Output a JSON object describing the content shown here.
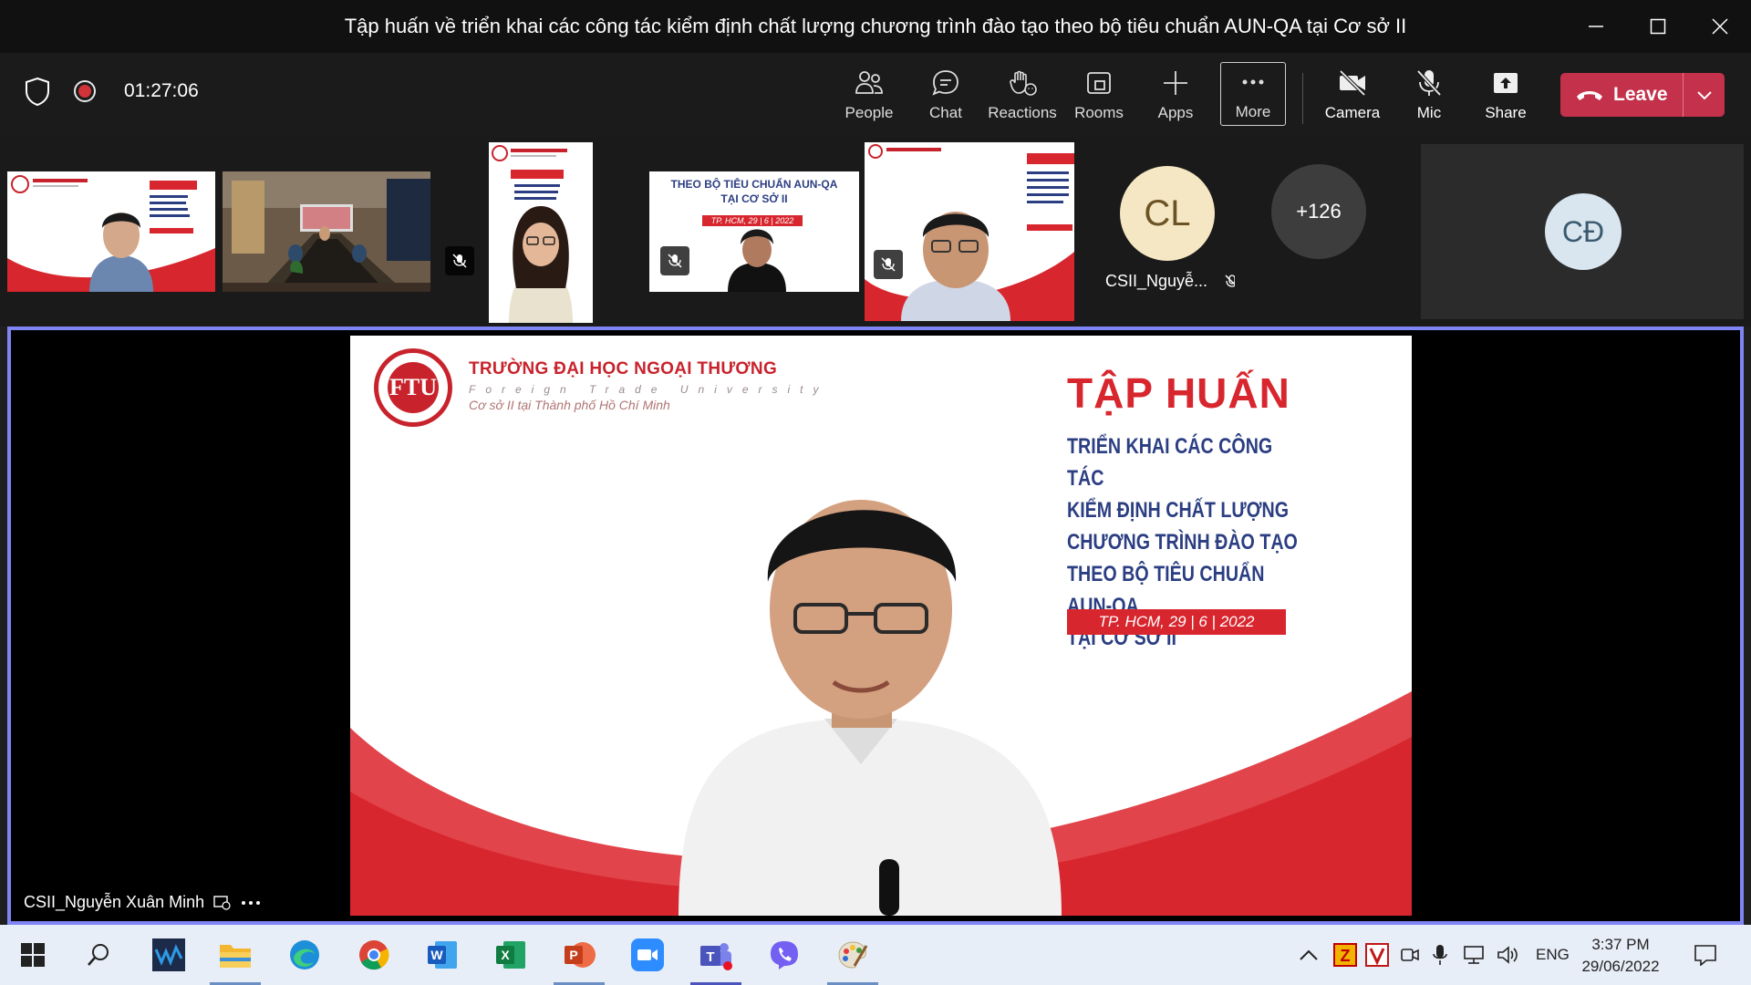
{
  "window": {
    "title": "Tập huấn về triển khai các công tác kiểm định chất lượng chương trình đào tạo theo bộ tiêu chuẩn AUN-QA tại Cơ sở II"
  },
  "toolbar": {
    "timer": "01:27:06",
    "buttons": {
      "people": "People",
      "chat": "Chat",
      "reactions": "Reactions",
      "rooms": "Rooms",
      "apps": "Apps",
      "more": "More",
      "camera": "Camera",
      "mic": "Mic",
      "share": "Share"
    },
    "leave": "Leave",
    "leave_color": "#c4314b"
  },
  "strip": {
    "tile3_slide_line1": "THEO BỘ TIÊU CHUẨN AUN-QA",
    "tile3_slide_line2": "TẠI CƠ SỞ II",
    "tile3_slide_date": "TP. HCM, 29 | 6 | 2022",
    "avatar_cl": {
      "initials": "CL",
      "name": "CSII_Nguyễ..."
    },
    "overflow": "+126",
    "avatar_cd": {
      "initials": "CĐ"
    }
  },
  "stage": {
    "speaker_name": "CSII_Nguyễn Xuân Minh",
    "slide": {
      "university": "TRƯỜNG ĐẠI HỌC NGOẠI THƯƠNG",
      "university_en": "Foreign Trade University",
      "campus": "Cơ sở II tại Thành phố Hồ Chí Minh",
      "logo_letters": "FTU",
      "title": "TẬP HUẤN",
      "lines": [
        "TRIỂN KHAI CÁC CÔNG TÁC",
        "KIỂM ĐỊNH CHẤT LƯỢNG",
        "CHƯƠNG TRÌNH ĐÀO TẠO",
        "THEO BỘ TIÊU CHUẨN AUN-QA",
        "TẠI CƠ SỞ II"
      ],
      "date": "TP. HCM, 29 | 6 | 2022"
    },
    "border_color": "#7f85f5"
  },
  "taskbar": {
    "tray_language": "ENG",
    "clock_time": "3:37 PM",
    "clock_date": "29/06/2022"
  }
}
